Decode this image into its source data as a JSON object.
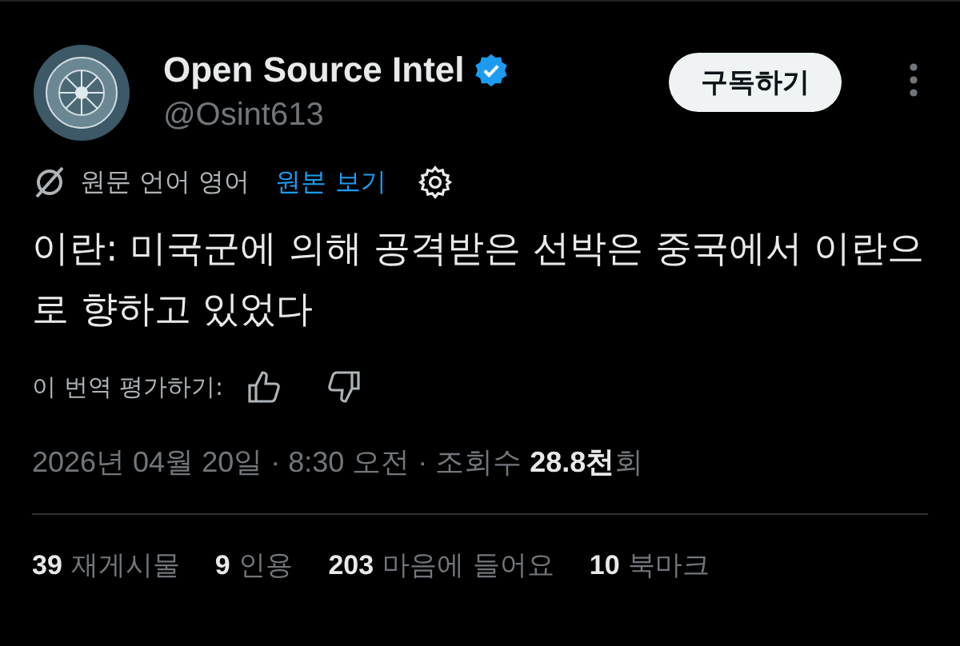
{
  "author": {
    "name": "Open Source Intel",
    "verified": true,
    "handle": "@Osint613"
  },
  "subscribe_button": "구독하기",
  "translation": {
    "note": "원문 언어 영어",
    "show_original": "원본 보기"
  },
  "post_text": "이란: 미국군에 의해 공격받은 선박은 중국에서 이란으로 향하고 있었다",
  "rate": {
    "label": "이 번역 평가하기:"
  },
  "meta": "2026년 04월 20일 · 8:30 오전 · 조회수 **28.8천**회",
  "stats": [
    {
      "text": "**39** 재게시물"
    },
    {
      "text": "**9** 인용"
    },
    {
      "text": "**203** 마음에 들어요"
    },
    {
      "text": "**10** 북마크"
    }
  ]
}
